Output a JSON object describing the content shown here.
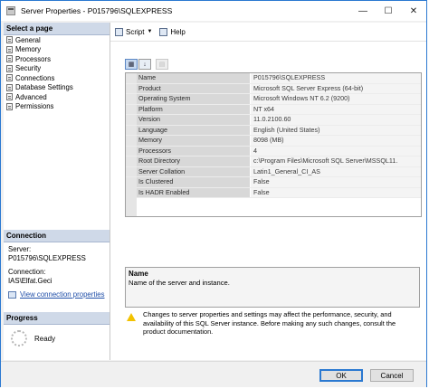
{
  "window": {
    "title": "Server Properties - P015796\\SQLEXPRESS",
    "minimize": "—",
    "maximize": "☐",
    "close": "✕"
  },
  "left": {
    "select_page_header": "Select a page",
    "pages": [
      "General",
      "Memory",
      "Processors",
      "Security",
      "Connections",
      "Database Settings",
      "Advanced",
      "Permissions"
    ],
    "connection_header": "Connection",
    "server_label": "Server:",
    "server_value": "P015796\\SQLEXPRESS",
    "connection_label": "Connection:",
    "connection_value": "IAS\\Elfat.Geci",
    "view_connection_link": "View connection properties",
    "progress_header": "Progress",
    "progress_status": "Ready"
  },
  "toolbar": {
    "script_label": "Script",
    "help_label": "Help"
  },
  "properties": [
    {
      "name": "Name",
      "value": "P015796\\SQLEXPRESS"
    },
    {
      "name": "Product",
      "value": "Microsoft SQL Server Express (64-bit)"
    },
    {
      "name": "Operating System",
      "value": "Microsoft Windows NT 6.2 (9200)"
    },
    {
      "name": "Platform",
      "value": "NT x64"
    },
    {
      "name": "Version",
      "value": "11.0.2100.60"
    },
    {
      "name": "Language",
      "value": "English (United States)"
    },
    {
      "name": "Memory",
      "value": "8098 (MB)"
    },
    {
      "name": "Processors",
      "value": "4"
    },
    {
      "name": "Root Directory",
      "value": "c:\\Program Files\\Microsoft SQL Server\\MSSQL11."
    },
    {
      "name": "Server Collation",
      "value": "Latin1_General_CI_AS"
    },
    {
      "name": "Is Clustered",
      "value": "False"
    },
    {
      "name": "Is HADR Enabled",
      "value": "False"
    }
  ],
  "description": {
    "title": "Name",
    "text": "Name of the server and instance."
  },
  "warning": "Changes to server properties and settings may affect the performance, security, and availability of this SQL Server instance. Before making any such changes, consult the product documentation.",
  "buttons": {
    "ok": "OK",
    "cancel": "Cancel"
  },
  "icons": {
    "categorized": "categorized-icon",
    "alphabetical": "alphabetical-sort-icon",
    "property_pages": "property-pages-icon"
  }
}
